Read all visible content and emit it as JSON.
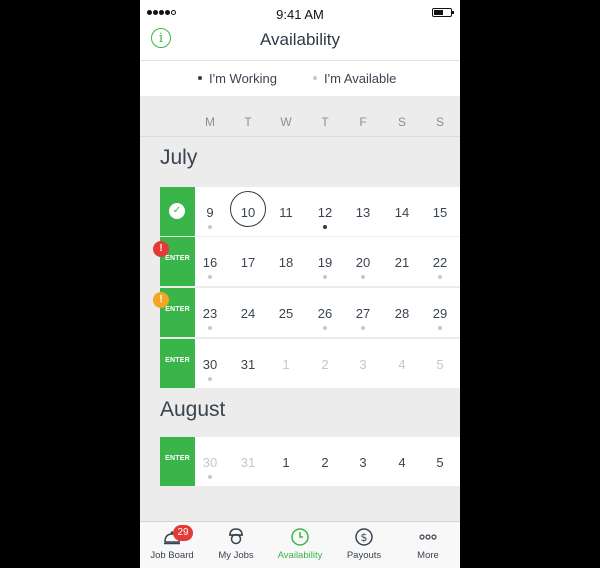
{
  "status_bar": {
    "time": "9:41 AM"
  },
  "nav": {
    "title": "Availability",
    "info_icon": "info-icon"
  },
  "legend": {
    "working": {
      "label": "I'm Working",
      "color": "#2f3a46"
    },
    "available": {
      "label": "I'm Available",
      "color": "#c6c9cd"
    }
  },
  "weekdays": [
    "M",
    "T",
    "W",
    "T",
    "F",
    "S",
    "S"
  ],
  "months": [
    {
      "name": "July",
      "weeks": [
        {
          "tab": "check",
          "badge": null,
          "days": [
            {
              "n": "9",
              "mark": "available"
            },
            {
              "n": "10",
              "today": true
            },
            {
              "n": "11"
            },
            {
              "n": "12",
              "mark": "working"
            },
            {
              "n": "13"
            },
            {
              "n": "14"
            },
            {
              "n": "15"
            }
          ]
        },
        {
          "tab": "ENTER",
          "badge": "error",
          "days": [
            {
              "n": "16",
              "mark": "available"
            },
            {
              "n": "17"
            },
            {
              "n": "18"
            },
            {
              "n": "19",
              "mark": "available"
            },
            {
              "n": "20",
              "mark": "available"
            },
            {
              "n": "21"
            },
            {
              "n": "22",
              "mark": "available"
            }
          ]
        },
        {
          "tab": "ENTER",
          "badge": "warning",
          "days": [
            {
              "n": "23",
              "mark": "available"
            },
            {
              "n": "24"
            },
            {
              "n": "25"
            },
            {
              "n": "26",
              "mark": "available"
            },
            {
              "n": "27",
              "mark": "available"
            },
            {
              "n": "28"
            },
            {
              "n": "29",
              "mark": "available"
            }
          ]
        },
        {
          "tab": "ENTER",
          "badge": null,
          "days": [
            {
              "n": "30",
              "mark": "available"
            },
            {
              "n": "31"
            },
            {
              "n": "1",
              "muted": true
            },
            {
              "n": "2",
              "muted": true
            },
            {
              "n": "3",
              "muted": true
            },
            {
              "n": "4",
              "muted": true
            },
            {
              "n": "5",
              "muted": true
            }
          ]
        }
      ]
    },
    {
      "name": "August",
      "weeks": [
        {
          "tab": "ENTER",
          "badge": null,
          "days": [
            {
              "n": "30",
              "muted": true,
              "mark": "available"
            },
            {
              "n": "31",
              "muted": true
            },
            {
              "n": "1"
            },
            {
              "n": "2"
            },
            {
              "n": "3"
            },
            {
              "n": "4"
            },
            {
              "n": "5"
            }
          ]
        }
      ]
    }
  ],
  "badges": {
    "error": {
      "symbol": "!",
      "color": "#e53935"
    },
    "warning": {
      "symbol": "!",
      "color": "#f5a623"
    }
  },
  "tab_bar": [
    {
      "label": "Job Board",
      "icon": "service-bell-icon",
      "count": "29"
    },
    {
      "label": "My Jobs",
      "icon": "worker-icon"
    },
    {
      "label": "Availability",
      "icon": "clock-icon",
      "active": true
    },
    {
      "label": "Payouts",
      "icon": "dollar-icon"
    },
    {
      "label": "More",
      "icon": "more-icon"
    }
  ],
  "colors": {
    "accent": "#3ab54a",
    "text": "#3a4450",
    "muted": "#c4c7cb"
  }
}
